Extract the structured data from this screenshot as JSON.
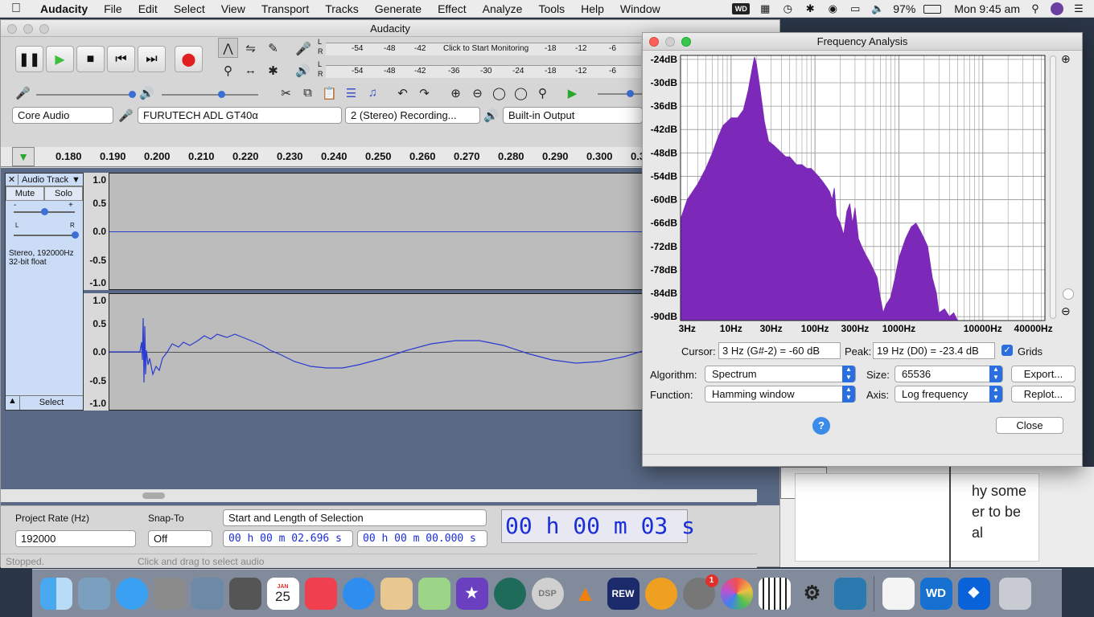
{
  "menubar": {
    "app_name": "Audacity",
    "items": [
      "File",
      "Edit",
      "Select",
      "View",
      "Transport",
      "Tracks",
      "Generate",
      "Effect",
      "Analyze",
      "Tools",
      "Help",
      "Window"
    ],
    "battery": "97%",
    "clock": "Mon 9:45 am",
    "wd_label": "WD"
  },
  "main": {
    "title": "Audacity",
    "monitor_hint": "Click to Start Monitoring",
    "meter_ticks_top": [
      "-54",
      "-48",
      "-42",
      "-18",
      "-12",
      "-6"
    ],
    "meter_ticks_bottom": [
      "-54",
      "-48",
      "-42",
      "-36",
      "-30",
      "-24",
      "-18",
      "-12",
      "-6"
    ],
    "meter_l": "L",
    "meter_r": "R",
    "device": {
      "host": "Core Audio",
      "input": "FURUTECH ADL GT40α",
      "channels": "2 (Stereo) Recording...",
      "output": "Built-in Output"
    },
    "ruler_ticks": [
      "0.180",
      "0.190",
      "0.200",
      "0.210",
      "0.220",
      "0.230",
      "0.240",
      "0.250",
      "0.260",
      "0.270",
      "0.280",
      "0.290",
      "0.300",
      "0.3"
    ],
    "track": {
      "name": "Audio Track",
      "mute": "Mute",
      "solo": "Solo",
      "info_line1": "Stereo, 192000Hz",
      "info_line2": "32-bit float",
      "select": "Select",
      "gain_minus": "-",
      "gain_plus": "+",
      "pan_l": "L",
      "pan_r": "R",
      "scale": [
        "1.0",
        "0.5",
        "0.0",
        "-0.5",
        "-1.0"
      ]
    },
    "bottom": {
      "project_rate_label": "Project Rate (Hz)",
      "project_rate": "192000",
      "snap_label": "Snap-To",
      "snap_value": "Off",
      "selection_mode": "Start and Length of Selection",
      "sel_start": "00 h 00 m 02.696 s",
      "sel_length": "00 h 00 m 00.000 s",
      "big_time": "00 h 00 m 03 s"
    },
    "status": "Stopped.",
    "status_hint": "Click and drag to select audio"
  },
  "freq": {
    "title": "Frequency Analysis",
    "cursor_label": "Cursor:",
    "cursor_value": "3 Hz (G#-2) = -60 dB",
    "peak_label": "Peak:",
    "peak_value": "19 Hz (D0) = -23.4 dB",
    "grids_label": "Grids",
    "algorithm_label": "Algorithm:",
    "algorithm": "Spectrum",
    "size_label": "Size:",
    "size": "65536",
    "function_label": "Function:",
    "function": "Hamming window",
    "axis_label": "Axis:",
    "axis": "Log frequency",
    "export": "Export...",
    "replot": "Replot...",
    "close": "Close",
    "help": "?",
    "color": "#7c28b8"
  },
  "chart_data": {
    "type": "area",
    "xscale": "log",
    "x_tick_labels": [
      "3Hz",
      "10Hz",
      "30Hz",
      "100Hz",
      "300Hz",
      "1000Hz",
      "10000Hz",
      "40000Hz"
    ],
    "y_tick_labels": [
      "-24dB",
      "-30dB",
      "-36dB",
      "-42dB",
      "-48dB",
      "-54dB",
      "-60dB",
      "-66dB",
      "-72dB",
      "-78dB",
      "-84dB",
      "-90dB"
    ],
    "ylim": [
      -91,
      -23
    ],
    "xlim": [
      2.5,
      55000
    ],
    "grid": true,
    "series": [
      {
        "x": [
          2.5,
          3,
          4,
          5,
          6,
          7,
          8,
          9,
          10,
          12,
          14,
          16,
          18,
          19,
          20,
          22,
          25,
          28,
          32,
          36,
          40,
          45,
          50,
          55,
          60,
          70,
          80,
          90,
          100,
          110,
          120,
          130,
          140,
          150,
          160,
          170,
          180,
          200,
          220,
          240,
          260,
          280,
          300,
          330,
          360,
          400,
          450,
          500,
          550,
          600,
          650,
          700,
          800,
          900,
          1000,
          1200,
          1400,
          1600,
          1800,
          2000,
          2200,
          2500,
          2800,
          3000,
          3500,
          4000,
          4500,
          5000,
          5500,
          6000
        ],
        "y": [
          -65,
          -60,
          -56,
          -52,
          -48,
          -44,
          -41,
          -40,
          -39,
          -39,
          -37,
          -32,
          -26,
          -23.4,
          -25,
          -31,
          -40,
          -45,
          -46,
          -47,
          -48,
          -49,
          -49,
          -50,
          -51,
          -51,
          -52,
          -52,
          -53,
          -54,
          -55,
          -56,
          -57,
          -58,
          -60,
          -57,
          -64,
          -66,
          -69,
          -63,
          -61,
          -66,
          -62,
          -70,
          -72,
          -74,
          -76,
          -78,
          -80,
          -85,
          -89,
          -87,
          -85,
          -80,
          -75,
          -70,
          -67,
          -66,
          -68,
          -70,
          -72,
          -80,
          -84,
          -89,
          -88,
          -90,
          -89,
          -91,
          -91,
          -91
        ]
      }
    ]
  },
  "dock": {
    "icons": [
      "finder-icon",
      "preview-icon",
      "messages-icon",
      "calculator-icon",
      "image-capture-icon",
      "photo-booth-icon",
      "calendar-icon",
      "news-icon",
      "safari-icon",
      "files-icon",
      "maps-icon",
      "imovie-icon",
      "time-machine-icon",
      "dsp-icon",
      "vlc-icon",
      "rew-icon",
      "audacity-icon",
      "system-preferences-icon",
      "photos-icon",
      "piano-icon",
      "microscope-icon",
      "preview-window-icon",
      "textedit-icon",
      "wd-icon",
      "dropbox-icon",
      "trash-icon"
    ],
    "calendar_month": "JAN",
    "calendar_day": "25",
    "rew_label": "REW",
    "dsp_label": "DSP",
    "wd_label": "WD",
    "badge": "1"
  },
  "background_text": {
    "line1": "hy some",
    "line2": "er to be",
    "line3": "al"
  }
}
